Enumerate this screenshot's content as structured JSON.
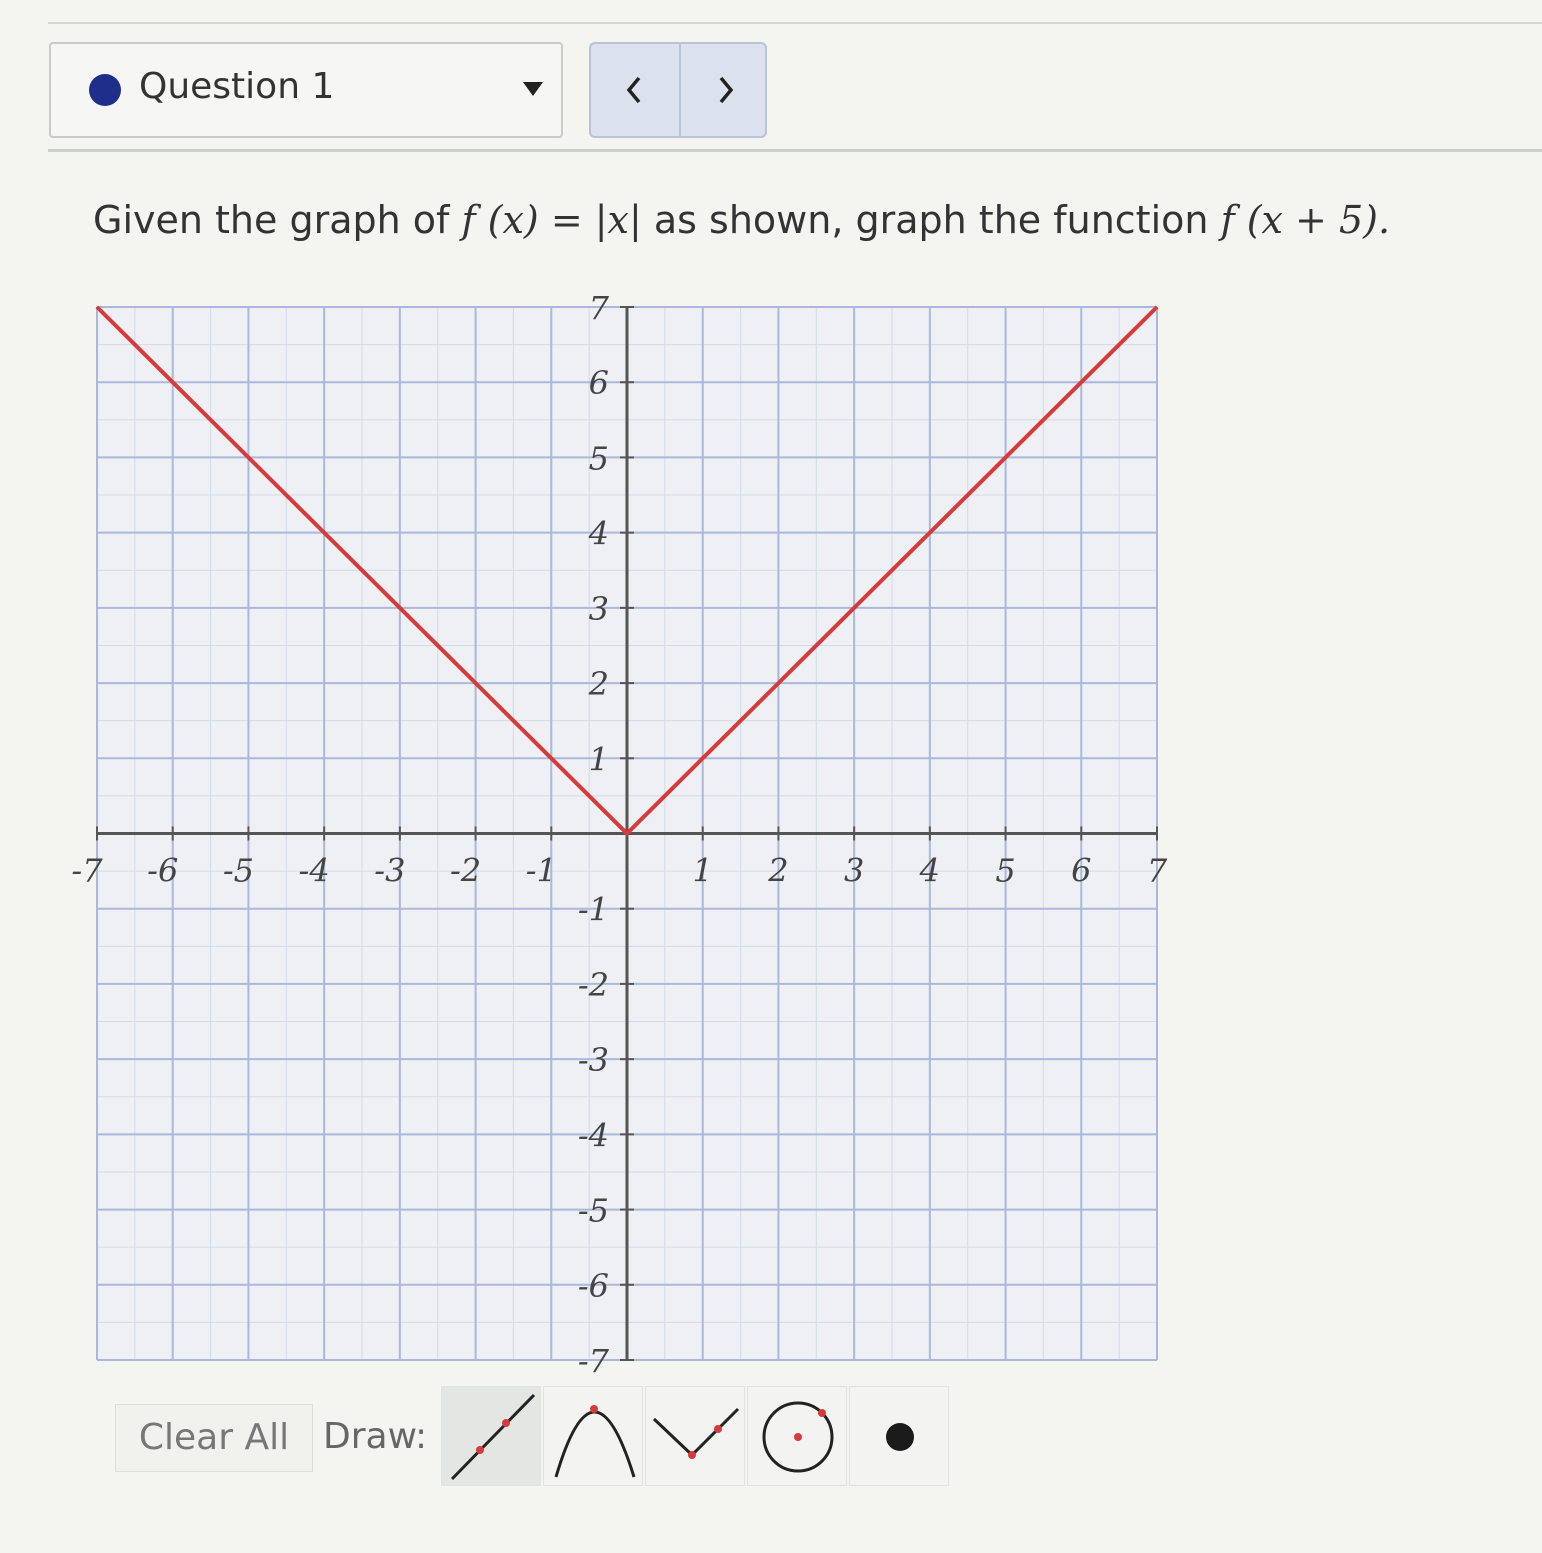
{
  "question_selector": {
    "label": "Question 1"
  },
  "prompt": {
    "text_1": "Given the graph of",
    "math_1": "f (x) = |x|",
    "text_2": "as shown, graph the function",
    "math_2": "f (x + 5)."
  },
  "toolbar": {
    "clear_label": "Clear All",
    "draw_label": "Draw:",
    "tools": [
      "line-tool-icon",
      "parabola-tool-icon",
      "absolute-value-tool-icon",
      "circle-tool-icon",
      "point-tool-icon"
    ]
  },
  "colors": {
    "graph_line": "#d63a3a",
    "grid": "#a9b8dc",
    "axis": "#555555",
    "question_dot": "#1f2e8a"
  },
  "chart_data": {
    "type": "line",
    "title": "",
    "xlabel": "",
    "ylabel": "",
    "xlim": [
      -7,
      7
    ],
    "ylim": [
      -7,
      7
    ],
    "grid": true,
    "x_ticks": [
      "-7",
      "-6",
      "-5",
      "-4",
      "-3",
      "-2",
      "-1",
      "1",
      "2",
      "3",
      "4",
      "5",
      "6",
      "7"
    ],
    "y_ticks": [
      "7",
      "6",
      "5",
      "4",
      "3",
      "2",
      "1",
      "-1",
      "-2",
      "-3",
      "-4",
      "-5",
      "-6",
      "-7"
    ],
    "series": [
      {
        "x": [
          -7,
          0,
          7
        ],
        "y": [
          7,
          0,
          7
        ]
      }
    ]
  }
}
